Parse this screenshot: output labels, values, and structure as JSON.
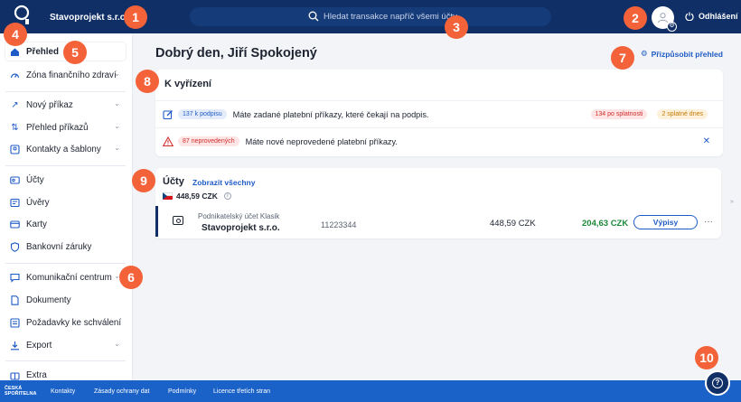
{
  "header": {
    "company": "Stavoprojekt s.r.o.",
    "search_placeholder": "Hledat transakce napříč všemi účty",
    "logout_label": "Odhlášení"
  },
  "sidebar": {
    "items": [
      {
        "label": "Přehled",
        "icon": "home-icon"
      },
      {
        "label": "Zóna finančního zdraví",
        "icon": "gauge-icon"
      },
      {
        "label": "Nový příkaz",
        "icon": "arrow-up-right-icon"
      },
      {
        "label": "Přehled příkazů",
        "icon": "transfer-arrows-icon"
      },
      {
        "label": "Kontakty a šablony",
        "icon": "contacts-icon"
      },
      {
        "label": "Účty",
        "icon": "account-icon"
      },
      {
        "label": "Úvěry",
        "icon": "loan-icon"
      },
      {
        "label": "Karty",
        "icon": "card-icon"
      },
      {
        "label": "Bankovní záruky",
        "icon": "shield-icon"
      },
      {
        "label": "Komunikační centrum",
        "icon": "chat-icon"
      },
      {
        "label": "Dokumenty",
        "icon": "document-icon"
      },
      {
        "label": "Požadavky ke schválení",
        "icon": "request-icon"
      },
      {
        "label": "Export",
        "icon": "download-icon"
      },
      {
        "label": "Extra",
        "icon": "extra-icon"
      }
    ]
  },
  "main": {
    "greeting": "Dobrý den, Jiří Spokojený",
    "customize_label": "Přizpůsobit přehled",
    "todo": {
      "title": "K vyřízení",
      "rows": [
        {
          "badge": "137 k podpisu",
          "message": "Máte zadané platební příkazy, které čekají na podpis.",
          "tags": [
            "134 po splatnosti",
            "2 splatné dnes"
          ]
        },
        {
          "badge": "87 neprovedených",
          "message": "Máte nové neprovedené platební příkazy.",
          "close": "✕"
        }
      ]
    },
    "accounts": {
      "title": "Účty",
      "show_all": "Zobrazit všechny",
      "total": "448,59 CZK",
      "info": "i",
      "list": [
        {
          "type": "Podnikatelský účet Klasik",
          "name": "Stavoprojekt s.r.o.",
          "number": "11223344",
          "balance": "448,59 CZK",
          "available": "204,63 CZK",
          "action": "Výpisy",
          "more": "···"
        }
      ]
    }
  },
  "footer": {
    "logo_line1": "ČESKÁ",
    "logo_line2": "SPOŘITELNA",
    "links": [
      "Kontakty",
      "Zásady ochrany dat",
      "Podmínky",
      "Licence třetích stran"
    ]
  },
  "help_label": "?",
  "markers": [
    "1",
    "2",
    "3",
    "4",
    "5",
    "6",
    "7",
    "8",
    "9",
    "10"
  ],
  "colors": {
    "header_bg": "#0f2f66",
    "accent": "#1f5bc6",
    "footer_bg": "#1a62c8",
    "marker": "#f4623a",
    "positive": "#1d8a3b"
  }
}
